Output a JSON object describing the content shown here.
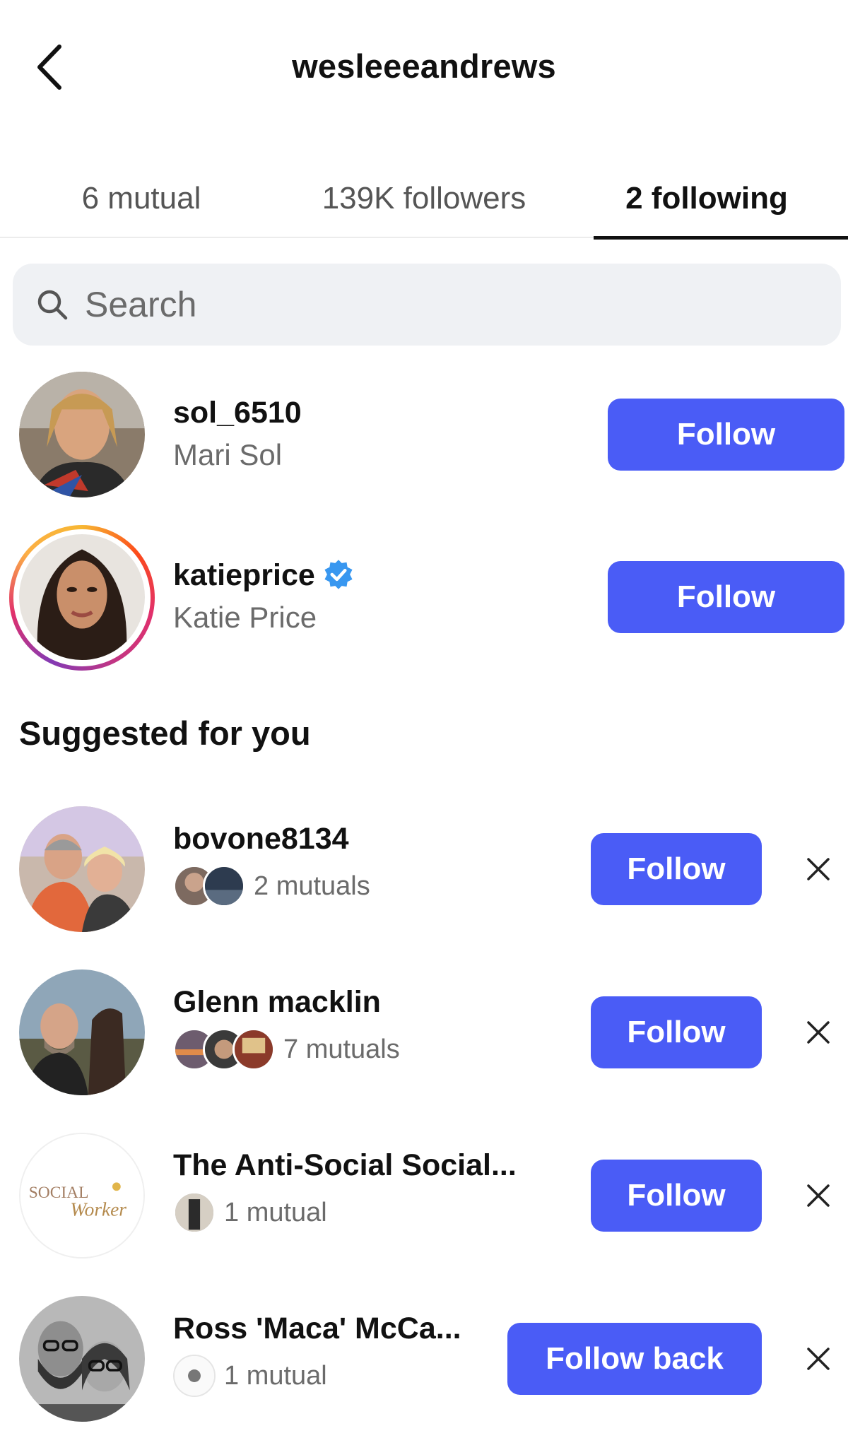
{
  "header": {
    "title": "wesleeeandrews"
  },
  "tabs": [
    {
      "label": "6 mutual"
    },
    {
      "label": "139K followers"
    },
    {
      "label": "2 following"
    }
  ],
  "search": {
    "placeholder": "Search"
  },
  "following": [
    {
      "username": "sol_6510",
      "name": "Mari Sol",
      "button": "Follow"
    },
    {
      "username": "katieprice",
      "name": "Katie Price",
      "verified": true,
      "button": "Follow"
    }
  ],
  "suggested": {
    "title": "Suggested for you",
    "items": [
      {
        "username": "bovone8134",
        "mutuals": "2 mutuals",
        "button": "Follow"
      },
      {
        "username": "Glenn macklin",
        "mutuals": "7 mutuals",
        "button": "Follow"
      },
      {
        "username": "The Anti-Social Social...",
        "mutuals": "1 mutual",
        "button": "Follow",
        "avatar_text_1": "SOCIAL",
        "avatar_text_2": "Worker"
      },
      {
        "username": "Ross 'Maca' McCa...",
        "mutuals": "1 mutual",
        "button": "Follow back"
      }
    ]
  },
  "colors": {
    "accent": "#4a5cf6",
    "verified": "#3897f0",
    "muted": "#6b6b6b"
  },
  "icons": {
    "back": "chevron-left-icon",
    "search": "search-icon",
    "dismiss": "close-icon",
    "verified": "verified-badge-icon"
  }
}
